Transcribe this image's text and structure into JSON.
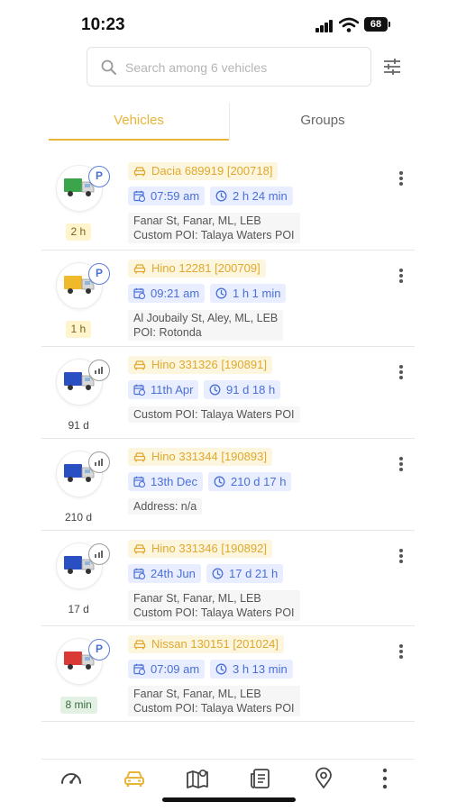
{
  "status_bar": {
    "time": "10:23",
    "battery": "68"
  },
  "search": {
    "placeholder": "Search among 6 vehicles",
    "value": ""
  },
  "tabs": [
    {
      "label": "Vehicles",
      "active": true
    },
    {
      "label": "Groups",
      "active": false
    }
  ],
  "colors": {
    "accent": "#e8b53a",
    "chip_blue": "#4a6fd6",
    "parking_badge": "#5a7ed8"
  },
  "vehicles": [
    {
      "name": "Dacia 689919 [200718]",
      "time": "07:59 am",
      "elapsed": "2 h 24 min",
      "duration": "2 h",
      "duration_style": "yellow",
      "status": "parking",
      "truck_color": "#3aa54a",
      "address_line1": "Fanar St, Fanar, ML, LEB",
      "address_line2": "Custom POI: Talaya Waters POI"
    },
    {
      "name": "Hino 12281 [200709]",
      "time": "09:21 am",
      "elapsed": "1 h 1 min",
      "duration": "1 h",
      "duration_style": "yellow",
      "status": "parking",
      "truck_color": "#f0b92b",
      "address_line1": "Al Joubaily St, Aley, ML, LEB",
      "address_line2": "POI: Rotonda"
    },
    {
      "name": "Hino 331326 [190891]",
      "time": "11th Apr",
      "elapsed": "91 d 18 h",
      "duration": "91 d",
      "duration_style": "gray",
      "status": "no-signal",
      "truck_color": "#2a4fc2",
      "address_line1": "Custom POI: Talaya Waters POI",
      "address_line2": ""
    },
    {
      "name": "Hino 331344 [190893]",
      "time": "13th Dec",
      "elapsed": "210 d 17 h",
      "duration": "210 d",
      "duration_style": "gray",
      "status": "no-signal",
      "truck_color": "#2a4fc2",
      "address_line1": "Address: n/a",
      "address_line2": ""
    },
    {
      "name": "Hino 331346 [190892]",
      "time": "24th Jun",
      "elapsed": "17 d 21 h",
      "duration": "17 d",
      "duration_style": "gray",
      "status": "no-signal",
      "truck_color": "#2a4fc2",
      "address_line1": "Fanar St, Fanar, ML, LEB",
      "address_line2": "Custom POI: Talaya Waters POI"
    },
    {
      "name": "Nissan 130151 [201024]",
      "time": "07:09 am",
      "elapsed": "3 h 13 min",
      "duration": "8 min",
      "duration_style": "green",
      "status": "parking",
      "truck_color": "#d93a35",
      "address_line1": "Fanar St, Fanar, ML, LEB",
      "address_line2": "Custom POI: Talaya Waters POI"
    }
  ],
  "bottom_nav": [
    {
      "icon": "speedometer-icon",
      "active": false
    },
    {
      "icon": "car-icon",
      "active": true
    },
    {
      "icon": "map-icon",
      "active": false
    },
    {
      "icon": "report-icon",
      "active": false
    },
    {
      "icon": "location-pin-icon",
      "active": false
    },
    {
      "icon": "more-vertical-icon",
      "active": false
    }
  ]
}
